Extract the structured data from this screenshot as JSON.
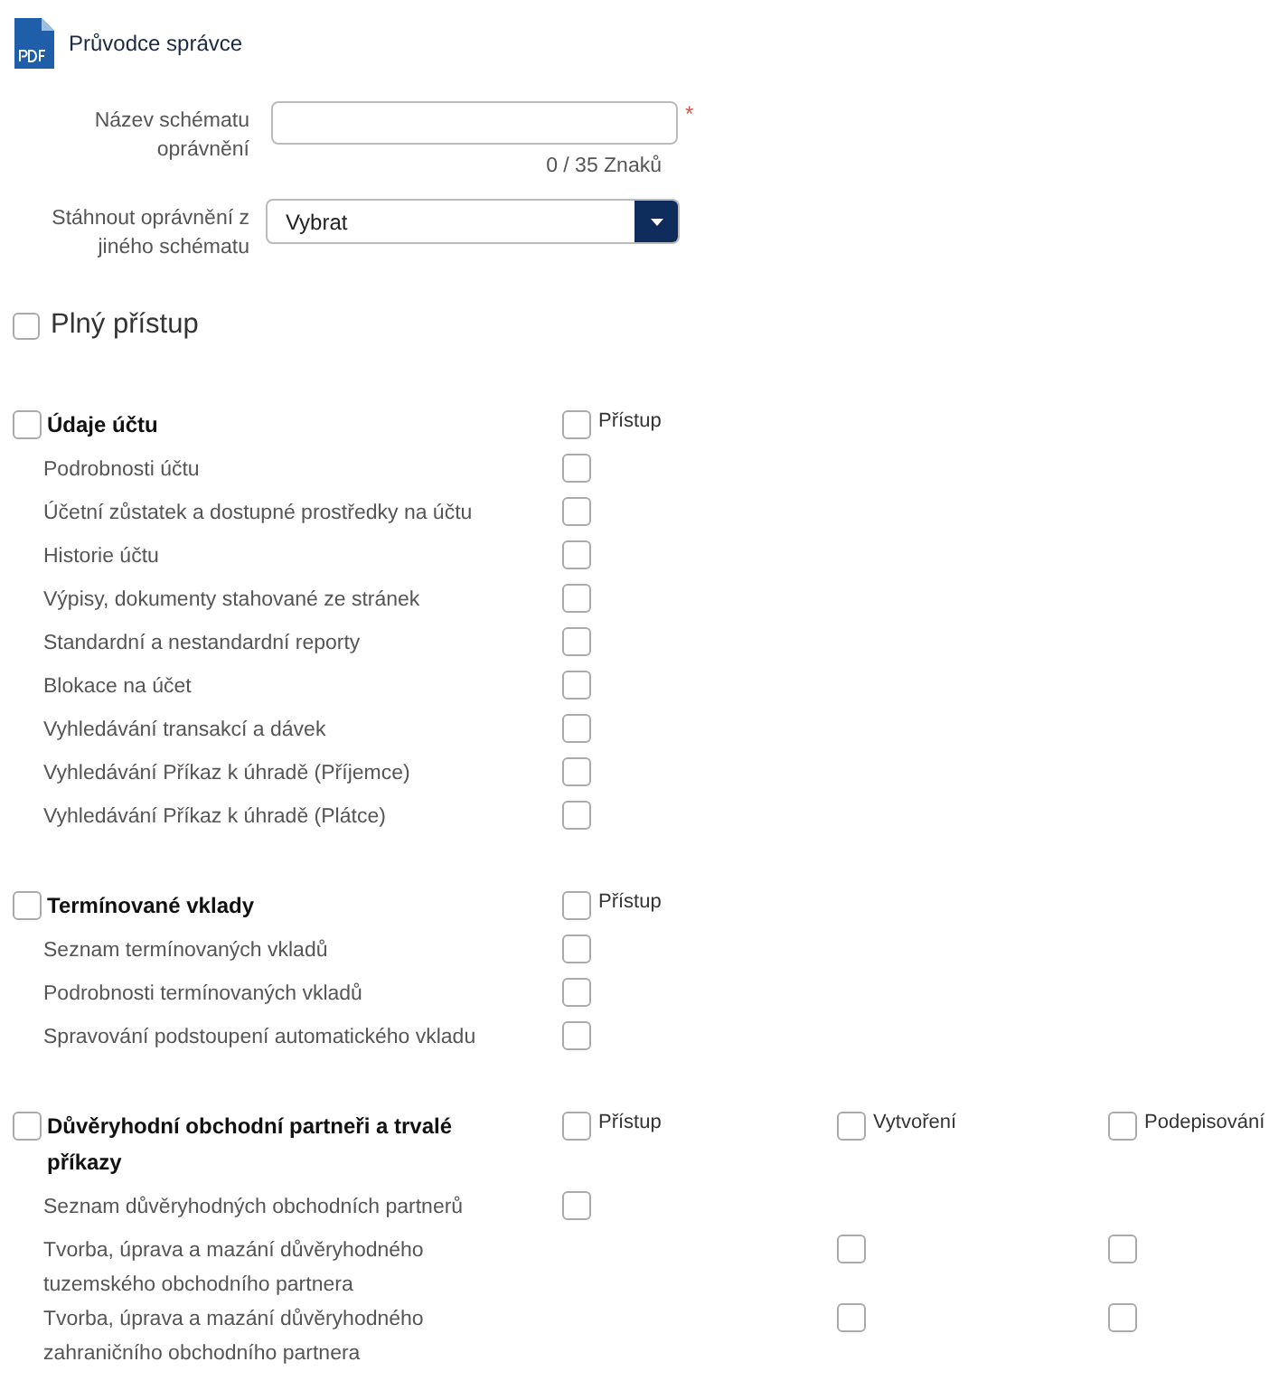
{
  "guide_link": {
    "label": "Průvodce správce"
  },
  "form": {
    "name_field": {
      "label": "Název schématu oprávnění",
      "required_mark": "*",
      "counter": "0 / 35 Znaků"
    },
    "copy_select": {
      "label": "Stáhnout oprávnění z jiného schématu",
      "value": "Vybrat"
    }
  },
  "full_access": {
    "label": "Plný přístup",
    "checked": false
  },
  "sections": [
    {
      "title": "Údaje účtu",
      "checked": false,
      "columns": [
        {
          "label": "Přístup",
          "checked": false
        }
      ],
      "items": [
        {
          "label": "Podrobnosti účtu",
          "cells": [
            {
              "kind": "checkbox",
              "checked": false
            }
          ]
        },
        {
          "label": "Účetní zůstatek a dostupné prostředky na účtu",
          "cells": [
            {
              "kind": "checkbox",
              "checked": false
            }
          ]
        },
        {
          "label": "Historie účtu",
          "cells": [
            {
              "kind": "checkbox",
              "checked": false
            }
          ]
        },
        {
          "label": "Výpisy, dokumenty stahované ze stránek",
          "cells": [
            {
              "kind": "checkbox",
              "checked": false
            }
          ]
        },
        {
          "label": "Standardní a nestandardní reporty",
          "cells": [
            {
              "kind": "checkbox",
              "checked": false
            }
          ]
        },
        {
          "label": "Blokace na účet",
          "cells": [
            {
              "kind": "checkbox",
              "checked": false
            }
          ]
        },
        {
          "label": "Vyhledávání transakcí a dávek",
          "cells": [
            {
              "kind": "checkbox",
              "checked": false
            }
          ]
        },
        {
          "label": "Vyhledávání Příkaz k úhradě (Příjemce)",
          "cells": [
            {
              "kind": "checkbox",
              "checked": false
            }
          ]
        },
        {
          "label": "Vyhledávání Příkaz k úhradě (Plátce)",
          "cells": [
            {
              "kind": "checkbox",
              "checked": false
            }
          ]
        }
      ]
    },
    {
      "title": "Termínované vklady",
      "checked": false,
      "columns": [
        {
          "label": "Přístup",
          "checked": false
        }
      ],
      "items": [
        {
          "label": "Seznam termínovaných vkladů",
          "cells": [
            {
              "kind": "checkbox",
              "checked": false
            }
          ]
        },
        {
          "label": "Podrobnosti termínovaných vkladů",
          "cells": [
            {
              "kind": "checkbox",
              "checked": false
            }
          ]
        },
        {
          "label": "Spravování podstoupení automatického vkladu",
          "cells": [
            {
              "kind": "checkbox",
              "checked": false
            }
          ]
        }
      ]
    },
    {
      "title": "Důvěryhodní obchodní partneři a trvalé příkazy",
      "checked": false,
      "columns": [
        {
          "label": "Přístup",
          "checked": false
        },
        {
          "label": "Vytvoření",
          "checked": false
        },
        {
          "label": "Podepisování",
          "checked": false
        }
      ],
      "items": [
        {
          "label": "Seznam důvěryhodných obchodních partnerů",
          "cells": [
            {
              "kind": "checkbox",
              "checked": false
            },
            {
              "kind": "empty"
            },
            {
              "kind": "empty"
            }
          ]
        },
        {
          "label": "Tvorba, úprava a mazání důvěryhodného tuzemského obchodního partnera",
          "cells": [
            {
              "kind": "empty"
            },
            {
              "kind": "checkbox",
              "checked": false
            },
            {
              "kind": "checkbox",
              "checked": false
            }
          ]
        },
        {
          "label": "Tvorba, úprava a mazání důvěryhodného zahraničního obchodního partnera",
          "cells": [
            {
              "kind": "empty"
            },
            {
              "kind": "checkbox",
              "checked": false
            },
            {
              "kind": "checkbox",
              "checked": false
            }
          ]
        }
      ]
    }
  ]
}
